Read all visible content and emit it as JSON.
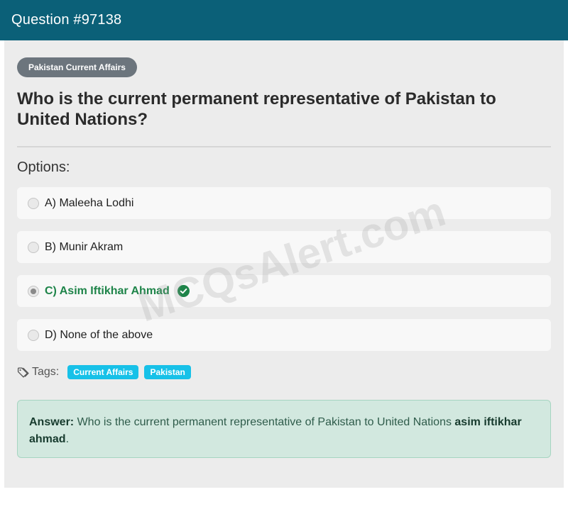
{
  "header": {
    "title": "Question #97138"
  },
  "category": {
    "label": "Pakistan Current Affairs"
  },
  "question": {
    "text": "Who is the current permanent representative of Pakistan to United Nations?"
  },
  "options_label": "Options:",
  "options": [
    {
      "label": "A) Maleeha Lodhi",
      "selected": false,
      "correct": false
    },
    {
      "label": "B) Munir Akram",
      "selected": false,
      "correct": false
    },
    {
      "label": "C) Asim Iftikhar Ahmad",
      "selected": true,
      "correct": true
    },
    {
      "label": "D) None of the above",
      "selected": false,
      "correct": false
    }
  ],
  "tags": {
    "label": "Tags:",
    "items": [
      "Current Affairs",
      "Pakistan"
    ],
    "icon": "tag-icon"
  },
  "answer": {
    "prefix": "Answer:",
    "text": "Who is the current permanent representative of Pakistan to United Nations",
    "value": "asim iftikhar ahmad",
    "suffix": "."
  },
  "watermark": "MCQsAlert.com",
  "colors": {
    "header_bg": "#0b6078",
    "correct": "#1e8449",
    "tag_bg": "#17c1e8",
    "answer_bg": "#d2e8df"
  }
}
